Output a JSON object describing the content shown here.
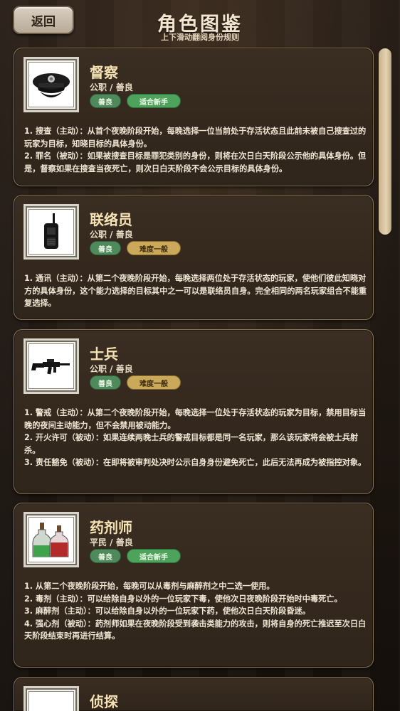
{
  "header": {
    "back_label": "返回",
    "title": "角色图鉴",
    "subtitle": "上下滑动翻阅身份规则"
  },
  "roles": [
    {
      "name": "督察",
      "meta": "公职 / 善良",
      "tags": [
        "善良",
        "适合新手"
      ],
      "icon": "police-cap-icon",
      "lines": [
        "1. 搜查（主动）：从首个夜晚阶段开始，每晚选择一位当前处于存活状态且此前未被自己搜查过的玩家为目标，知晓目标的具体身份。",
        "2. 罪名（被动）：如果被搜查目标是罪犯类别的身份，则将在次日白天阶段公示他的具体身份。但是，督察如果在搜查当夜死亡，则次日白天阶段不会公示目标的具体身份。"
      ]
    },
    {
      "name": "联络员",
      "meta": "公职 / 善良",
      "tags": [
        "善良",
        "难度一般"
      ],
      "icon": "walkie-talkie-icon",
      "lines": [
        "1. 通讯（主动）：从第二个夜晚阶段开始，每晚选择两位处于存活状态的玩家，使他们彼此知晓对方的具体身份，这个能力选择的目标其中之一可以是联络员自身。完全相同的两名玩家组合不能重复选择。"
      ]
    },
    {
      "name": "士兵",
      "meta": "公职 / 善良",
      "tags": [
        "善良",
        "难度一般"
      ],
      "icon": "rifle-icon",
      "lines": [
        "1. 警戒（主动）：从第二个夜晚阶段开始，每晚选择一位处于存活状态的玩家为目标，禁用目标当晚的夜间主动能力，但不会禁用被动能力。",
        "2. 开火许可（被动）：如果连续两晚士兵的警戒目标都是同一名玩家，那么该玩家将会被士兵射杀。",
        "3. 责任豁免（被动）：在即将被审判处决时公示自身身份避免死亡，此后无法再成为被指控对象。"
      ]
    },
    {
      "name": "药剂师",
      "meta": "平民 / 善良",
      "tags": [
        "善良",
        "适合新手"
      ],
      "icon": "potion-bottles-icon",
      "lines": [
        "1. 从第二个夜晚阶段开始，每晚可以从毒剂与麻醉剂之中二选一使用。",
        "2. 毒剂（主动）：可以给除自身以外的一位玩家下毒，使他次日夜晚阶段开始时中毒死亡。",
        "3. 麻醉剂（主动）：可以给除自身以外的一位玩家下药，使他次日白天阶段昏迷。",
        "4. 强心剂（被动）：药剂师如果在夜晚阶段受到袭击类能力的攻击，则将自身的死亡推迟至次日白天阶段结束时再进行结算。"
      ]
    },
    {
      "name": "侦探",
      "meta": "",
      "tags": [],
      "icon": "portrait-icon",
      "lines": []
    }
  ]
}
